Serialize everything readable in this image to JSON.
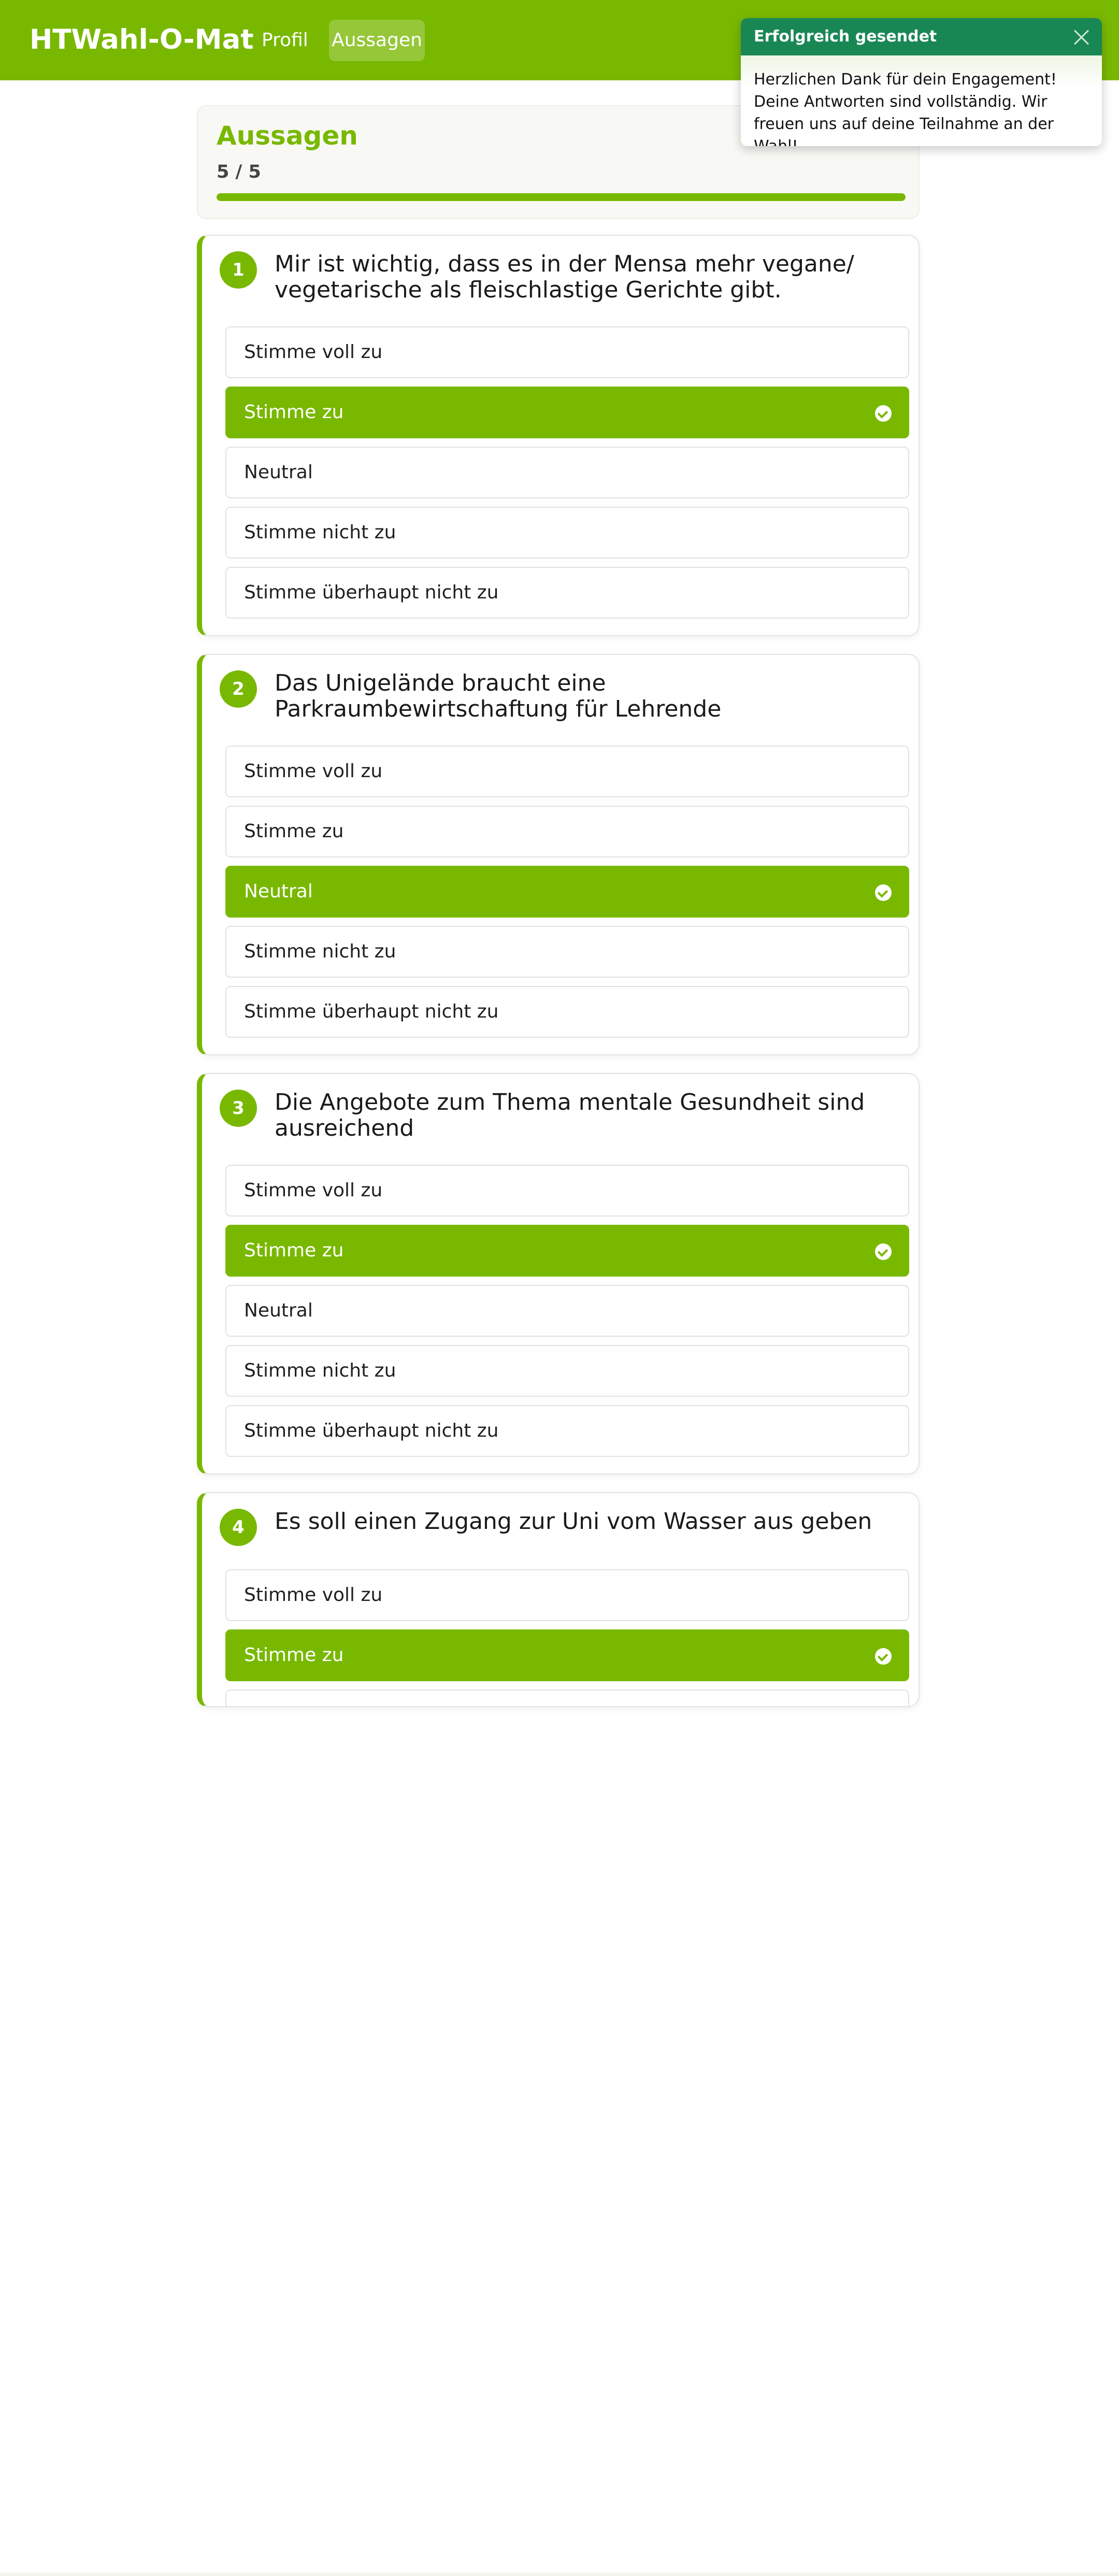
{
  "navbar": {
    "brand": "HTWahl-O-Mat",
    "links": [
      {
        "label": "Profil",
        "active": false
      },
      {
        "label": "Aussagen",
        "active": true
      }
    ]
  },
  "header": {
    "title": "Aussagen",
    "progress_text": "5 / 5",
    "progress_percent": 100
  },
  "questions": [
    {
      "number": "1",
      "text": "Mir ist wichtig, dass es in der Mensa mehr vegane/ vegetarische als fleischlastige Gerichte gibt.",
      "answers": [
        "Stimme voll zu",
        "Stimme zu",
        "Neutral",
        "Stimme nicht zu",
        "Stimme überhaupt nicht zu"
      ],
      "selected": 1
    },
    {
      "number": "2",
      "text": "Das Unigelände braucht eine Parkraumbewirtschaftung für Lehrende",
      "answers": [
        "Stimme voll zu",
        "Stimme zu",
        "Neutral",
        "Stimme nicht zu",
        "Stimme überhaupt nicht zu"
      ],
      "selected": 2
    },
    {
      "number": "3",
      "text": "Die Angebote zum Thema mentale Gesundheit sind ausreichend",
      "answers": [
        "Stimme voll zu",
        "Stimme zu",
        "Neutral",
        "Stimme nicht zu",
        "Stimme überhaupt nicht zu"
      ],
      "selected": 1
    },
    {
      "number": "4",
      "text": "Es soll einen Zugang zur Uni vom Wasser aus geben",
      "answers": [
        "Stimme voll zu",
        "Stimme zu",
        "",
        "",
        ""
      ],
      "selected": 1
    }
  ],
  "toast": {
    "title": "Erfolgreich gesendet",
    "message": "Herzlichen Dank für dein Engagement! Deine Antworten sind vollständig. Wir freuen uns auf deine Teilnahme an der Wahl!"
  },
  "colors": {
    "brand": "#79b800",
    "toast_header": "#198754"
  },
  "icons": {
    "selected_marker": "check-circle-icon",
    "toast_close": "close-icon"
  }
}
